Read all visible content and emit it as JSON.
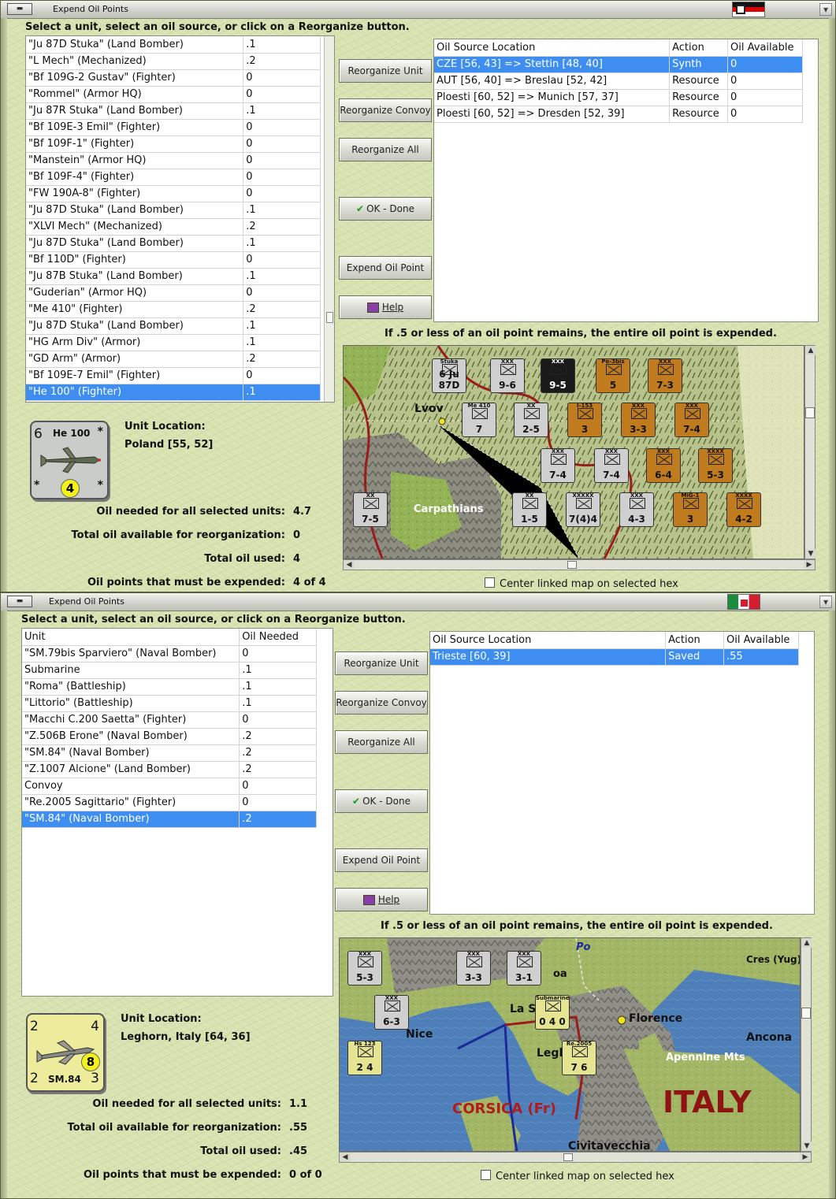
{
  "germany": {
    "title": "Expend Oil Points",
    "instruction": "Select a unit, select an oil source, or click on a Reorganize button.",
    "units": [
      {
        "name": "\"Ju 87D Stuka\" (Land Bomber)",
        "oil": ".1"
      },
      {
        "name": "\"L Mech\" (Mechanized)",
        "oil": ".2"
      },
      {
        "name": "\"Bf 109G-2 Gustav\" (Fighter)",
        "oil": "0"
      },
      {
        "name": "\"Rommel\" (Armor HQ)",
        "oil": "0"
      },
      {
        "name": "\"Ju 87R Stuka\" (Land Bomber)",
        "oil": ".1"
      },
      {
        "name": "\"Bf 109E-3 Emil\" (Fighter)",
        "oil": "0"
      },
      {
        "name": "\"Bf 109F-1\" (Fighter)",
        "oil": "0"
      },
      {
        "name": "\"Manstein\" (Armor HQ)",
        "oil": "0"
      },
      {
        "name": "\"Bf 109F-4\" (Fighter)",
        "oil": "0"
      },
      {
        "name": "\"FW 190A-8\" (Fighter)",
        "oil": "0"
      },
      {
        "name": "\"Ju 87D Stuka\" (Land Bomber)",
        "oil": ".1"
      },
      {
        "name": "\"XLVI Mech\" (Mechanized)",
        "oil": ".2"
      },
      {
        "name": "\"Ju 87D Stuka\" (Land Bomber)",
        "oil": ".1"
      },
      {
        "name": "\"Bf 110D\" (Fighter)",
        "oil": "0"
      },
      {
        "name": "\"Ju 87B Stuka\" (Land Bomber)",
        "oil": ".1"
      },
      {
        "name": "\"Guderian\" (Armor HQ)",
        "oil": "0"
      },
      {
        "name": "\"Me 410\" (Fighter)",
        "oil": ".2"
      },
      {
        "name": "\"Ju 87D Stuka\" (Land Bomber)",
        "oil": ".1"
      },
      {
        "name": "\"HG Arm Div\" (Armor)",
        "oil": ".1"
      },
      {
        "name": "\"GD Arm\" (Armor)",
        "oil": ".2"
      },
      {
        "name": "\"Bf 109E-7 Emil\" (Fighter)",
        "oil": "0"
      },
      {
        "name": "\"He 100\" (Fighter)",
        "oil": ".1",
        "selected": true
      }
    ],
    "buttons": {
      "reorganize_unit": "Reorganize Unit",
      "reorganize_convoy": "Reorganize Convoy",
      "reorganize_all": "Reorganize All",
      "ok_done": "OK - Done",
      "expend_oil": "Expend Oil Point",
      "help": "Help"
    },
    "sources_header": {
      "location": "Oil Source Location",
      "action": "Action",
      "available": "Oil Available"
    },
    "sources": [
      {
        "location": "CZE [56, 43] => Stettin [48, 40]",
        "action": "Synth",
        "available": "0",
        "selected": true
      },
      {
        "location": "AUT [56, 40] => Breslau [52, 42]",
        "action": "Resource",
        "available": "0"
      },
      {
        "location": "Ploesti [60, 52] => Munich [57, 37]",
        "action": "Resource",
        "available": "0"
      },
      {
        "location": "Ploesti [60, 52] => Dresden [52, 39]",
        "action": "Resource",
        "available": "0"
      }
    ],
    "note": "If .5 or less of an oil point remains, the entire oil point is expended.",
    "unit_card": {
      "name": "He 100",
      "top_left": "6",
      "center": "4",
      "corner": "*"
    },
    "unit_location_label": "Unit Location:",
    "unit_location": "Poland [55, 52]",
    "stats": {
      "needed_label": "Oil needed for all selected units:",
      "needed": "4.7",
      "available_label": "Total oil available for reorganization:",
      "available": "0",
      "used_label": "Total oil used:",
      "used": "4",
      "expended_label": "Oil points that must be expended:",
      "expended": "4 of 4"
    },
    "center_checkbox": "Center linked map on selected hex",
    "map_labels": {
      "city": "Lvov",
      "terrain": "Carpathians"
    },
    "map_counters": [
      {
        "label": "Stuka",
        "value": "6 Ju 87D",
        "color": "c-gr"
      },
      {
        "label": "XXX",
        "value": "9-6",
        "color": "c-gr"
      },
      {
        "label": "XXX",
        "value": "9-5",
        "color": "c-bk"
      },
      {
        "label": "Pe-3bis",
        "value": "5",
        "color": "c-br"
      },
      {
        "label": "XXX",
        "value": "7-3",
        "color": "c-br"
      },
      {
        "label": "Me 410",
        "value": "7",
        "color": "c-gr"
      },
      {
        "label": "XX",
        "value": "2-5",
        "color": "c-gr"
      },
      {
        "label": "I-153",
        "value": "3",
        "color": "c-br"
      },
      {
        "label": "XXX",
        "value": "3-3",
        "color": "c-br"
      },
      {
        "label": "XXX",
        "value": "7-4",
        "color": "c-br"
      },
      {
        "label": "XXX",
        "value": "7-4",
        "color": "c-gr"
      },
      {
        "label": "XXX",
        "value": "7-4",
        "color": "c-gr"
      },
      {
        "label": "XXX",
        "value": "6-4",
        "color": "c-br"
      },
      {
        "label": "XXXX",
        "value": "5-3",
        "color": "c-br"
      },
      {
        "label": "XX",
        "value": "7-5",
        "color": "c-gr"
      },
      {
        "label": "XX",
        "value": "1-5",
        "color": "c-gr"
      },
      {
        "label": "XXXXX",
        "value": "7(4)4",
        "color": "c-gr"
      },
      {
        "label": "XXX",
        "value": "4-3",
        "color": "c-gr"
      },
      {
        "label": "MiG-1",
        "value": "3",
        "color": "c-br"
      },
      {
        "label": "XXXX",
        "value": "4-2",
        "color": "c-br"
      }
    ]
  },
  "italy": {
    "title": "Expend Oil Points",
    "instruction": "Select a unit, select an oil source, or click on a Reorganize button.",
    "units_header": {
      "unit": "Unit",
      "oil": "Oil Needed"
    },
    "units": [
      {
        "name": "\"SM.79bis Sparviero\" (Naval Bomber)",
        "oil": "0"
      },
      {
        "name": "Submarine",
        "oil": ".1"
      },
      {
        "name": "\"Roma\" (Battleship)",
        "oil": ".1"
      },
      {
        "name": "\"Littorio\" (Battleship)",
        "oil": ".1"
      },
      {
        "name": "\"Macchi C.200 Saetta\" (Fighter)",
        "oil": "0"
      },
      {
        "name": "\"Z.506B Erone\" (Naval Bomber)",
        "oil": ".2"
      },
      {
        "name": "\"SM.84\" (Naval Bomber)",
        "oil": ".2"
      },
      {
        "name": "\"Z.1007 Alcione\" (Land Bomber)",
        "oil": ".2"
      },
      {
        "name": "Convoy",
        "oil": "0"
      },
      {
        "name": "\"Re.2005 Sagittario\" (Fighter)",
        "oil": "0"
      },
      {
        "name": "\"SM.84\" (Naval Bomber)",
        "oil": ".2",
        "selected": true
      }
    ],
    "buttons": {
      "reorganize_unit": "Reorganize Unit",
      "reorganize_convoy": "Reorganize Convoy",
      "reorganize_all": "Reorganize All",
      "ok_done": "OK - Done",
      "expend_oil": "Expend Oil Point",
      "help": "Help"
    },
    "sources_header": {
      "location": "Oil Source Location",
      "action": "Action",
      "available": "Oil Available"
    },
    "sources": [
      {
        "location": "Trieste [60, 39]",
        "action": "Saved",
        "available": ".55",
        "selected": true
      }
    ],
    "note": "If .5 or less of an oil point remains, the entire oil point is expended.",
    "unit_card": {
      "name": "SM.84",
      "top_left": "2",
      "top_right": "4",
      "center": "8",
      "bottom_left": "2",
      "bottom_right": "3"
    },
    "unit_location_label": "Unit Location:",
    "unit_location": "Leghorn, Italy [64, 36]",
    "stats": {
      "needed_label": "Oil needed for all selected units:",
      "needed": "1.1",
      "available_label": "Total oil available for reorganization:",
      "available": ".55",
      "used_label": "Total oil used:",
      "used": ".45",
      "expended_label": "Oil points that must be expended:",
      "expended": "0 of 0"
    },
    "center_checkbox": "Center linked map on selected hex",
    "map_labels": {
      "po": "Po",
      "cres": "Cres (Yug)",
      "la": "La S",
      "nice": "Nice",
      "florence": "Florence",
      "ancona": "Ancona",
      "apennine": "Apennine Mts",
      "legl": "Legl",
      "corsica": "CORSICA (Fr)",
      "italy": "ITALY",
      "civitavecchia": "Civitavecchia",
      "genoa": "oa"
    },
    "map_counters": [
      {
        "label": "XXX",
        "value": "5-3",
        "color": "c-gr"
      },
      {
        "label": "XXX",
        "value": "3-3",
        "color": "c-gr"
      },
      {
        "label": "XXX",
        "value": "3-1",
        "color": "c-gr"
      },
      {
        "label": "XXX",
        "value": "6-3",
        "color": "c-gr"
      },
      {
        "label": "Submarine",
        "value": "0 4 0",
        "color": "c-yl"
      },
      {
        "label": "Re.2005",
        "value": "7 6",
        "color": "c-yl"
      },
      {
        "label": "Hs 123",
        "value": "2 4",
        "color": "c-yl"
      }
    ]
  }
}
